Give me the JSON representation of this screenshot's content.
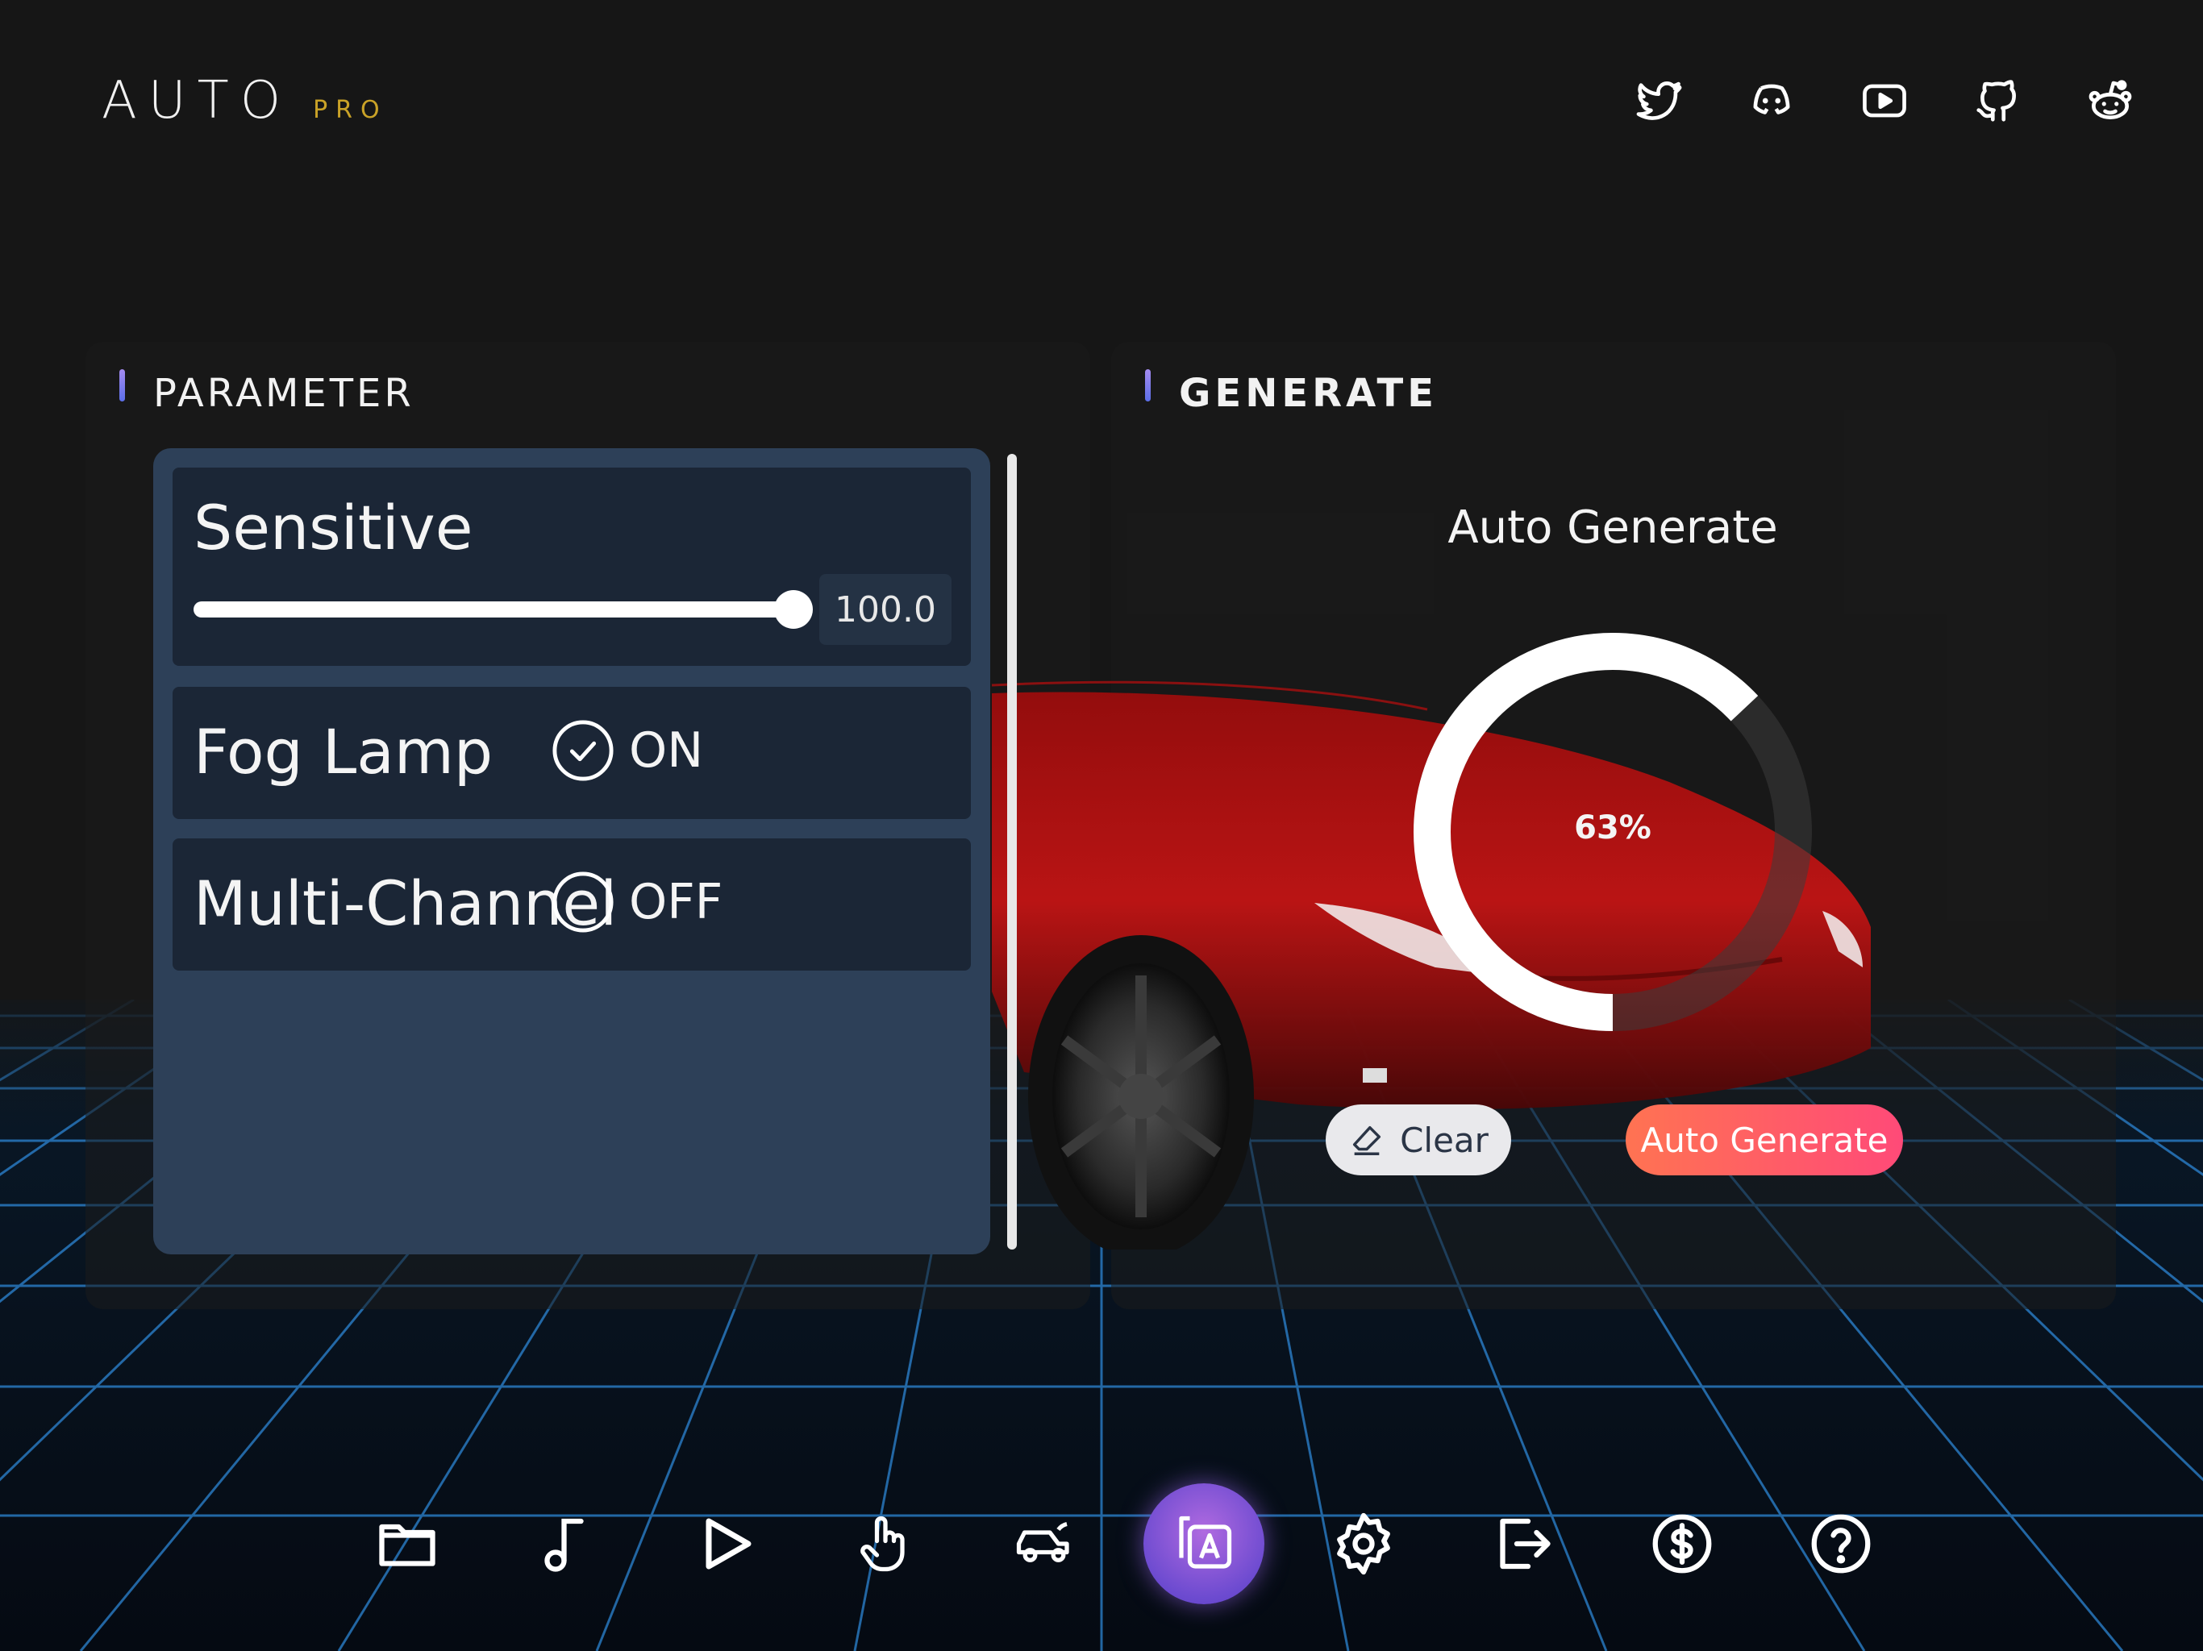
{
  "app": {
    "logo_main": "AUTO",
    "logo_sub": "PRO"
  },
  "socials": [
    {
      "icon": "twitter-icon"
    },
    {
      "icon": "discord-icon"
    },
    {
      "icon": "youtube-icon"
    },
    {
      "icon": "github-icon"
    },
    {
      "icon": "reddit-icon"
    }
  ],
  "parameter": {
    "title": "PARAMETER",
    "sensitive": {
      "label": "Sensitive",
      "value": "100.0",
      "fraction": 1.0
    },
    "fog_lamp": {
      "label": "Fog Lamp",
      "state": "ON"
    },
    "multi_channel": {
      "label": "Multi-Channel",
      "state": "OFF"
    }
  },
  "generate": {
    "title": "GENERATE",
    "heading": "Auto Generate",
    "progress": 63,
    "progress_label": "63%",
    "clear_label": "Clear",
    "auto_label": "Auto Generate"
  },
  "dock": {
    "items": [
      "folder-icon",
      "music-note-icon",
      "play-icon",
      "touch-icon",
      "car-icon",
      "auto-text-icon",
      "gear-icon",
      "exit-icon",
      "dollar-icon",
      "help-icon"
    ],
    "active_index": 5
  },
  "colors": {
    "accent": "#c9a227",
    "panel_blue": "#2d4058",
    "row_dark": "#1b2636",
    "btn_gradient_start": "#ff7352",
    "btn_gradient_end": "#ff4a78",
    "grid_line": "#2f8de0"
  }
}
